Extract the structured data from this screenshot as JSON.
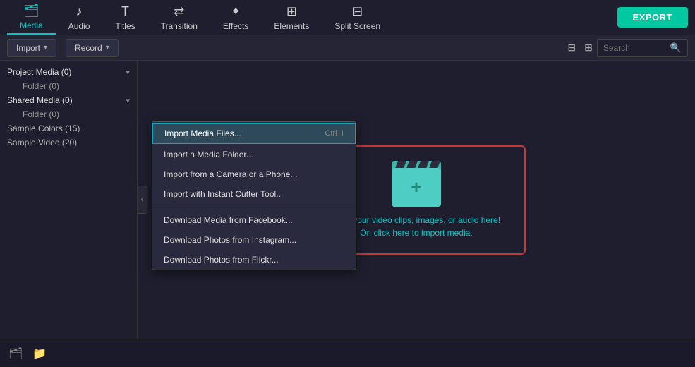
{
  "nav": {
    "items": [
      {
        "id": "media",
        "label": "Media",
        "icon": "🗂",
        "active": true
      },
      {
        "id": "audio",
        "label": "Audio",
        "icon": "♪"
      },
      {
        "id": "titles",
        "label": "Titles",
        "icon": "T"
      },
      {
        "id": "transition",
        "label": "Transition",
        "icon": "⇄"
      },
      {
        "id": "effects",
        "label": "Effects",
        "icon": "✦"
      },
      {
        "id": "elements",
        "label": "Elements",
        "icon": "⊞"
      },
      {
        "id": "splitscreen",
        "label": "Split Screen",
        "icon": "⊟"
      }
    ],
    "export_label": "EXPORT"
  },
  "toolbar": {
    "import_label": "Import",
    "record_label": "Record",
    "search_placeholder": "Search"
  },
  "sidebar": {
    "items": [
      {
        "id": "project-media",
        "label": "Project Media (0)",
        "type": "group",
        "indent": 0
      },
      {
        "id": "project-folder",
        "label": "Folder (0)",
        "type": "child",
        "indent": 1
      },
      {
        "id": "shared-media",
        "label": "Shared Media (0)",
        "type": "group",
        "indent": 0
      },
      {
        "id": "shared-folder",
        "label": "Folder (0)",
        "type": "child",
        "indent": 1
      },
      {
        "id": "sample-colors",
        "label": "Sample Colors (15)",
        "type": "item",
        "indent": 0
      },
      {
        "id": "sample-video",
        "label": "Sample Video (20)",
        "type": "item",
        "indent": 0
      }
    ]
  },
  "dropdown": {
    "items": [
      {
        "id": "import-files",
        "label": "Import Media Files...",
        "shortcut": "Ctrl+I",
        "highlighted": true
      },
      {
        "id": "import-folder",
        "label": "Import a Media Folder...",
        "shortcut": "",
        "highlighted": false
      },
      {
        "id": "import-camera",
        "label": "Import from a Camera or a Phone...",
        "shortcut": "",
        "highlighted": false
      },
      {
        "id": "import-cutter",
        "label": "Import with Instant Cutter Tool...",
        "shortcut": "",
        "highlighted": false
      },
      {
        "id": "download-facebook",
        "label": "Download Media from Facebook...",
        "shortcut": "",
        "highlighted": false
      },
      {
        "id": "download-instagram",
        "label": "Download Photos from Instagram...",
        "shortcut": "",
        "highlighted": false
      },
      {
        "id": "download-flickr",
        "label": "Download Photos from Flickr...",
        "shortcut": "",
        "highlighted": false
      }
    ]
  },
  "dropzone": {
    "line1": "Drop your video clips, images, or audio here!",
    "line2": "Or, click here to import media."
  },
  "colors": {
    "accent": "#00c8c8",
    "export_bg": "#00c8a0",
    "drop_border": "#cc3333",
    "highlighted_bg": "#2e4a5a"
  }
}
